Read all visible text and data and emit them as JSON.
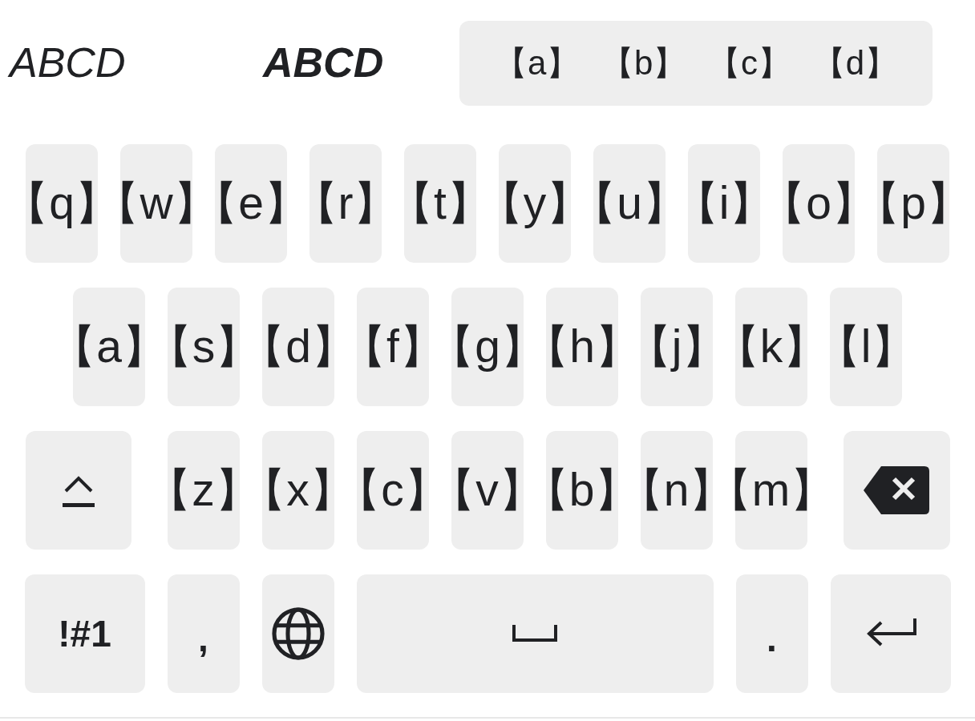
{
  "suggestions": [
    {
      "label": "ABCD",
      "kind": "italic",
      "selected": false
    },
    {
      "label": "ABCD",
      "kind": "bold-italic",
      "selected": false
    },
    {
      "label": "【a】 【b】 【c】 【d】",
      "kind": "plain",
      "selected": true
    }
  ],
  "keyboard": {
    "rows": [
      {
        "keys": [
          {
            "kind": "char",
            "label": "【q】"
          },
          {
            "kind": "char",
            "label": "【w】"
          },
          {
            "kind": "char",
            "label": "【e】"
          },
          {
            "kind": "char",
            "label": "【r】"
          },
          {
            "kind": "char",
            "label": "【t】"
          },
          {
            "kind": "char",
            "label": "【y】"
          },
          {
            "kind": "char",
            "label": "【u】"
          },
          {
            "kind": "char",
            "label": "【i】"
          },
          {
            "kind": "char",
            "label": "【o】"
          },
          {
            "kind": "char",
            "label": "【p】"
          }
        ]
      },
      {
        "keys": [
          {
            "kind": "char",
            "label": "【a】"
          },
          {
            "kind": "char",
            "label": "【s】"
          },
          {
            "kind": "char",
            "label": "【d】"
          },
          {
            "kind": "char",
            "label": "【f】"
          },
          {
            "kind": "char",
            "label": "【g】"
          },
          {
            "kind": "char",
            "label": "【h】"
          },
          {
            "kind": "char",
            "label": "【j】"
          },
          {
            "kind": "char",
            "label": "【k】"
          },
          {
            "kind": "char",
            "label": "【l】"
          }
        ]
      },
      {
        "keys": [
          {
            "kind": "shift"
          },
          {
            "kind": "char",
            "label": "【z】"
          },
          {
            "kind": "char",
            "label": "【x】"
          },
          {
            "kind": "char",
            "label": "【c】"
          },
          {
            "kind": "char",
            "label": "【v】"
          },
          {
            "kind": "char",
            "label": "【b】"
          },
          {
            "kind": "char",
            "label": "【n】"
          },
          {
            "kind": "char",
            "label": "【m】"
          },
          {
            "kind": "backspace"
          }
        ]
      },
      {
        "keys": [
          {
            "kind": "symbols",
            "label": "!#1"
          },
          {
            "kind": "punct",
            "label": ","
          },
          {
            "kind": "globe"
          },
          {
            "kind": "space"
          },
          {
            "kind": "punct",
            "label": "."
          },
          {
            "kind": "enter"
          }
        ]
      }
    ]
  }
}
